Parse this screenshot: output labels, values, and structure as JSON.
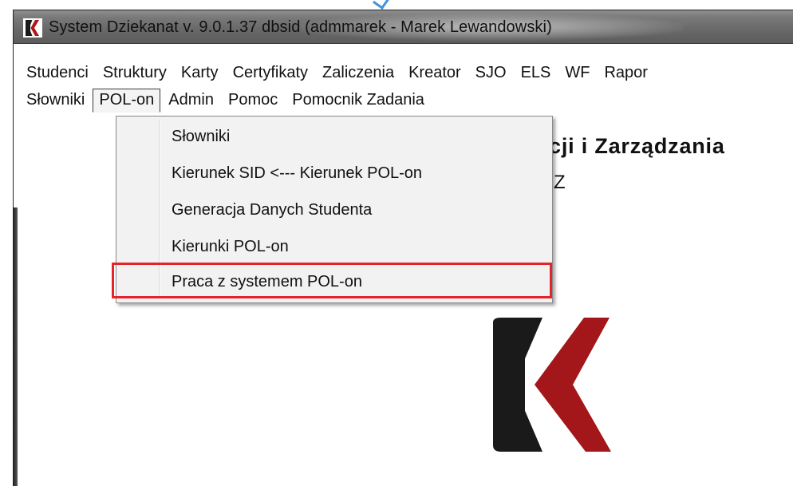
{
  "window": {
    "title": "System Dziekanat v. 9.0.1.37  dbsid  (admmarek - Marek Lewandowski)"
  },
  "menu": {
    "row1": [
      "Studenci",
      "Struktury",
      "Karty",
      "Certyfikaty",
      "Zaliczenia",
      "Kreator",
      "SJO",
      "ELS",
      "WF",
      "Rapor"
    ],
    "row2": [
      "Słowniki",
      "POL-on",
      "Admin",
      "Pomoc",
      "Pomocnik Zadania"
    ],
    "active": "POL-on"
  },
  "dropdown": {
    "items": [
      "Słowniki",
      "Kierunek SID <--- Kierunek POL-on",
      "Generacja Danych Studenta",
      "Kierunki POL-on",
      "Praca z systemem POL-on"
    ],
    "highlighted_index": 4
  },
  "background": {
    "heading_fragment": "cji i Zarządzania",
    "sub_fragment": "Z"
  },
  "colors": {
    "highlight_border": "#e3242b",
    "logo_dark": "#1a1a1a",
    "logo_red": "#a3161a"
  },
  "icons": {
    "app_icon": "dziekanat-logo-icon",
    "watermark": "dziekanat-logo-large"
  }
}
